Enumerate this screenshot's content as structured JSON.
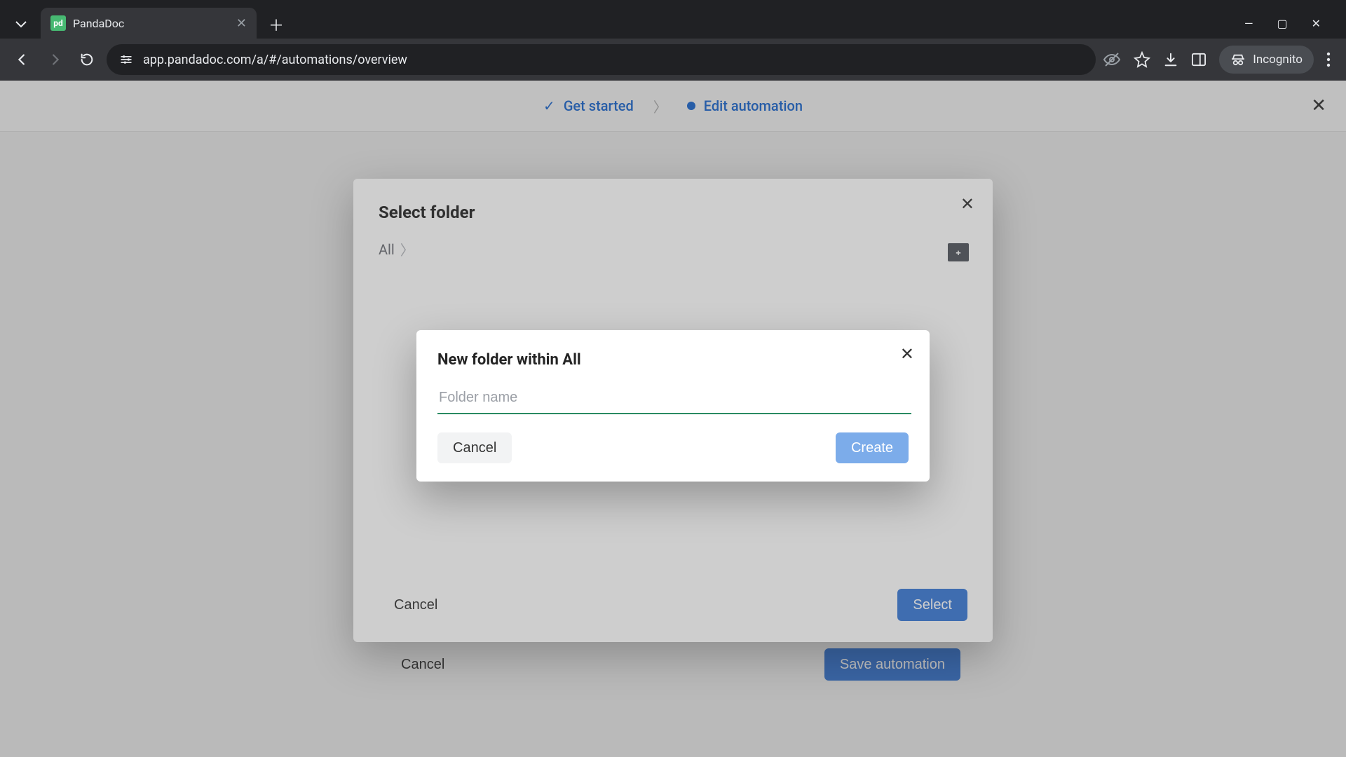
{
  "browser": {
    "tab_title": "PandaDoc",
    "url": "app.pandadoc.com/a/#/automations/overview",
    "incognito": "Incognito"
  },
  "header": {
    "step1": "Get started",
    "step2": "Edit automation"
  },
  "page_footer": {
    "cancel": "Cancel",
    "save": "Save automation"
  },
  "select_folder": {
    "title": "Select folder",
    "breadcrumb_root": "All",
    "cancel": "Cancel",
    "select": "Select"
  },
  "new_folder": {
    "title": "New folder within All",
    "placeholder": "Folder name",
    "value": "",
    "cancel": "Cancel",
    "create": "Create"
  }
}
